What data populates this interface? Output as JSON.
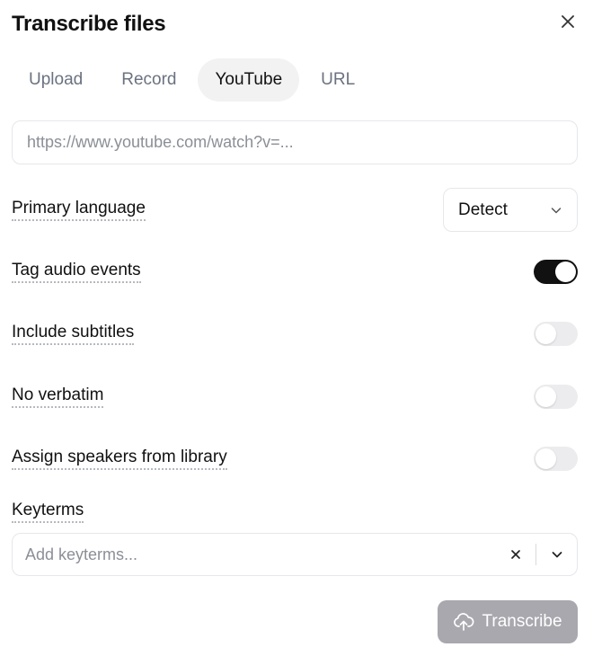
{
  "dialog": {
    "title": "Transcribe files",
    "close_icon": "close-icon"
  },
  "tabs": [
    {
      "label": "Upload",
      "active": false
    },
    {
      "label": "Record",
      "active": false
    },
    {
      "label": "YouTube",
      "active": true
    },
    {
      "label": "URL",
      "active": false
    }
  ],
  "url_input": {
    "value": "",
    "placeholder": "https://www.youtube.com/watch?v=..."
  },
  "primary_language": {
    "label": "Primary language",
    "selected": "Detect",
    "icon": "chevron-down-icon"
  },
  "options": {
    "tag_audio_events": {
      "label": "Tag audio events",
      "enabled": true
    },
    "include_subtitles": {
      "label": "Include subtitles",
      "enabled": false
    },
    "no_verbatim": {
      "label": "No verbatim",
      "enabled": false
    },
    "assign_speakers": {
      "label": "Assign speakers from library",
      "enabled": false
    }
  },
  "keyterms": {
    "label": "Keyterms",
    "value": "",
    "placeholder": "Add keyterms...",
    "clear_icon": "close-icon",
    "expand_icon": "chevron-down-icon"
  },
  "submit": {
    "label": "Transcribe",
    "icon": "cloud-upload-icon",
    "disabled": true
  },
  "colors": {
    "toggle_on": "#111111",
    "toggle_off": "#ececee",
    "submit_disabled": "#a8a8ae",
    "active_tab_bg": "#f2f2f2"
  }
}
